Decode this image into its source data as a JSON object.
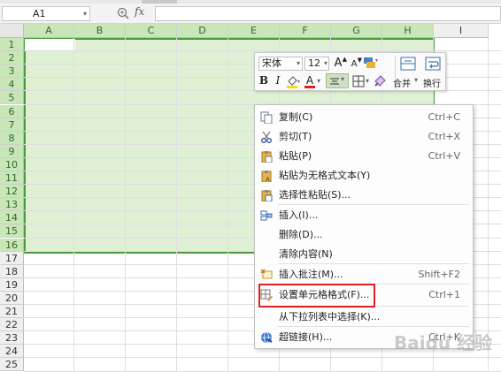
{
  "formula_bar": {
    "name_box": "A1",
    "name_box_arrow": "▾",
    "zoom_glyph": "⊕",
    "fx": "fx",
    "formula": ""
  },
  "columns": [
    "A",
    "B",
    "C",
    "D",
    "E",
    "F",
    "G",
    "H",
    "I"
  ],
  "rows": [
    "1",
    "2",
    "3",
    "4",
    "5",
    "6",
    "7",
    "8",
    "9",
    "10",
    "11",
    "12",
    "13",
    "14",
    "15",
    "16",
    "17",
    "18",
    "19",
    "20",
    "21",
    "22",
    "23",
    "24",
    "25"
  ],
  "selection": {
    "range": "A1:H16",
    "active_cell": "A1"
  },
  "mini_toolbar": {
    "font_name": "宋体",
    "font_size": "12",
    "grow_font": "A",
    "shrink_font": "A",
    "bold": "B",
    "italic": "I",
    "font_color": "A",
    "merge_label": "合并",
    "wrap_label": "换行",
    "dropdown_glyph": "▾"
  },
  "context_menu": {
    "items": [
      {
        "label": "复制(C)",
        "shortcut": "Ctrl+C",
        "icon": "copy-icon"
      },
      {
        "label": "剪切(T)",
        "shortcut": "Ctrl+X",
        "icon": "scissors-icon"
      },
      {
        "label": "粘贴(P)",
        "shortcut": "Ctrl+V",
        "icon": "paste-icon"
      },
      {
        "label": "粘贴为无格式文本(Y)",
        "shortcut": "",
        "icon": "paste-text-icon"
      },
      {
        "label": "选择性粘贴(S)...",
        "shortcut": "",
        "icon": "paste-special-icon"
      },
      {
        "label": "插入(I)...",
        "shortcut": "",
        "icon": "insert-icon"
      },
      {
        "label": "删除(D)...",
        "shortcut": "",
        "icon": ""
      },
      {
        "label": "清除内容(N)",
        "shortcut": "",
        "icon": ""
      },
      {
        "label": "插入批注(M)...",
        "shortcut": "Shift+F2",
        "icon": "comment-icon"
      },
      {
        "label": "设置单元格格式(F)...",
        "shortcut": "Ctrl+1",
        "icon": "format-cells-icon"
      },
      {
        "label": "从下拉列表中选择(K)...",
        "shortcut": "",
        "icon": ""
      },
      {
        "label": "超链接(H)...",
        "shortcut": "Ctrl+K",
        "icon": "hyperlink-icon"
      }
    ],
    "highlighted": "设置单元格格式(F)..."
  },
  "watermark": "Baidu 经验",
  "colors": {
    "selection_fill": "#dff0d5",
    "selection_border": "#4a9a3e",
    "highlight_border": "#e02020"
  }
}
